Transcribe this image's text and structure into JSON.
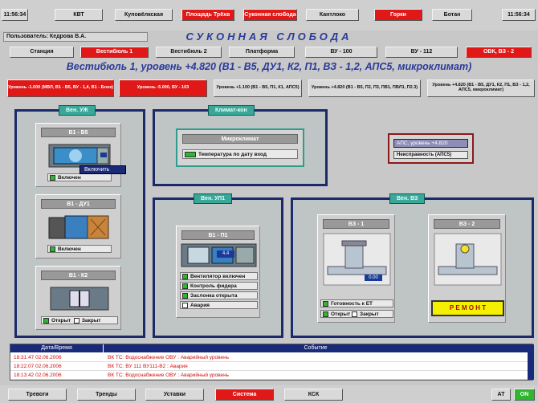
{
  "top_nav": {
    "left_time": "11:56:34",
    "items": [
      "КВТ",
      "Куповёлкская",
      "Площадь Трёхв",
      "Суконная слобода",
      "Кантлоко",
      "Горки",
      "Ботан"
    ],
    "right_time": "11:56:34"
  },
  "user_bar": {
    "user": "Пользователь: Кедрова В.А."
  },
  "station_title": "СУКОННАЯ СЛОБОДА",
  "sub_nav": [
    "Станция",
    "Вестибюль 1",
    "Вестибюль 2",
    "Платформа",
    "ВУ - 100",
    "ВУ - 112",
    "ОВК, ВЗ - 2"
  ],
  "section_title": "Вестибюль 1, уровень +4.820 (В1 - В5, ДУ1, К2, П1, ВЗ - 1,2, АПС5, микроклимат)",
  "level_tabs": [
    "Уровень -1.000 (МВЛ, В1 - В5, ВУ - 1,4, В1 - Блок)",
    "Уровень -5.000, ВУ - 103",
    "Уровень +1.100 (В1 - В5, П1, К1, АПС5)",
    "Уровень +4.820 (В1 - В5, П2, П3, ПВ1, ПВЛ1, П2.3)",
    "Уровень +4.820 (В1 - В5, ДУ1, К2, П1, ВЗ - 1,2, АПС5, микроклимат)"
  ],
  "panels": {
    "left": {
      "title": "Вен. УЖ",
      "units": [
        {
          "label": "В1 - В5",
          "status": "Включен"
        },
        {
          "label": "В1 - ДУ1",
          "status": "Включен"
        },
        {
          "label": "В1 - К2",
          "status_open": "Открыт",
          "status_closed": "Закрыт"
        }
      ],
      "tooltip": "Включить"
    },
    "climate": {
      "title": "Климат-кон",
      "header": "Микроклимат",
      "row": "Температура по дату вход"
    },
    "aps": {
      "line1": "АПС, уровень +4.820",
      "line2": "Неисправность (АПС5)"
    },
    "mid": {
      "title": "Вен. УЛ1",
      "unit_label": "В1 - П1",
      "readout": "4.4",
      "statuses": [
        "Вентилятор включен",
        "Контроль фидера",
        "Заслонка открыта",
        "Авария"
      ]
    },
    "right": {
      "title": "Вен. ВЗ",
      "unit1": {
        "label": "ВЗ - 1",
        "readout": "0.00",
        "status": "Готовность к ЕТ",
        "open": "Открыт",
        "closed": "Закрыт"
      },
      "unit2": {
        "label": "ВЗ - 2",
        "repair": "Р Е М О Н Т"
      }
    }
  },
  "events": {
    "headers": [
      "Дата/Время",
      "Событие"
    ],
    "rows": [
      {
        "time": "18:31:47  02.06.2006",
        "text": "ВК ТС: Водоснабжение ОВУ : Аварийный уровень"
      },
      {
        "time": "18:22:07  02.06.2006",
        "text": "ВК ТС: ВУ 111 ВУ111-В2 : Авария"
      },
      {
        "time": "18:13:42  02.06.2006",
        "text": "ВК ТС: Водоснабжение ОВУ : Аварийный уровень"
      }
    ]
  },
  "bottom_nav": [
    "Тревоги",
    "Тренды",
    "Уставки",
    "Система",
    "КСК"
  ],
  "bottom_right": {
    "code": "АТ",
    "indicator": "ON"
  }
}
